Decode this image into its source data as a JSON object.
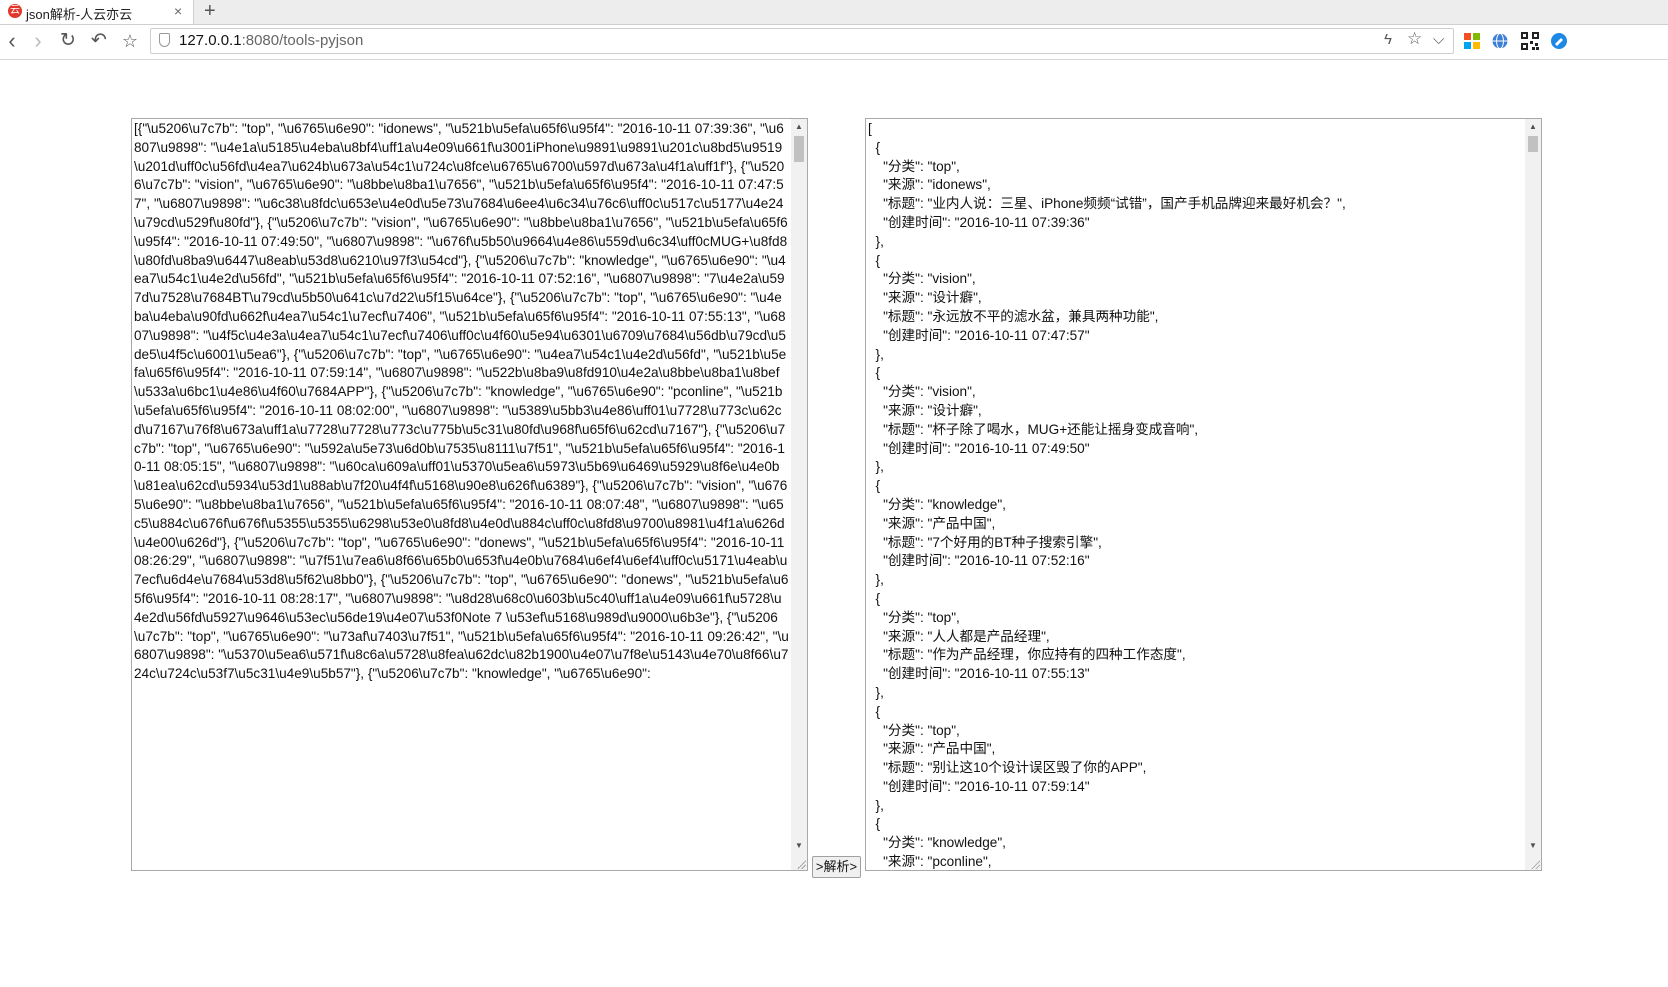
{
  "browser": {
    "tab": {
      "favicon": "云",
      "title": "json解析-人云亦云",
      "close": "×"
    },
    "new_tab": "+",
    "address": {
      "host": "127.0.0.1",
      "rest": ":8080/tools-pyjson"
    },
    "icons": [
      "back-icon",
      "forward-icon",
      "reload-icon",
      "undo-icon",
      "star-icon",
      "shield-icon",
      "lightning-icon",
      "bookmark-star-icon",
      "dropdown-icon",
      "apps-icon",
      "globe-icon",
      "qr-code-icon",
      "extension-icon"
    ],
    "glyphs": {
      "back": "‹",
      "forward": "›",
      "reload": "↻",
      "undo": "↶",
      "star": "☆",
      "lightning": "ϟ",
      "dropdown": "⌵"
    }
  },
  "input": {
    "text": "[{\"\\u5206\\u7c7b\": \"top\", \"\\u6765\\u6e90\": \"idonews\", \"\\u521b\\u5efa\\u65f6\\u95f4\": \"2016-10-11 07:39:36\", \"\\u6807\\u9898\": \"\\u4e1a\\u5185\\u4eba\\u8bf4\\uff1a\\u4e09\\u661f\\u3001iPhone\\u9891\\u9891\\u201c\\u8bd5\\u9519\\u201d\\uff0c\\u56fd\\u4ea7\\u624b\\u673a\\u54c1\\u724c\\u8fce\\u6765\\u6700\\u597d\\u673a\\u4f1a\\uff1f\"}, {\"\\u5206\\u7c7b\": \"vision\", \"\\u6765\\u6e90\": \"\\u8bbe\\u8ba1\\u7656\", \"\\u521b\\u5efa\\u65f6\\u95f4\": \"2016-10-11 07:47:57\", \"\\u6807\\u9898\": \"\\u6c38\\u8fdc\\u653e\\u4e0d\\u5e73\\u7684\\u6ee4\\u6c34\\u76c6\\uff0c\\u517c\\u5177\\u4e24\\u79cd\\u529f\\u80fd\"}, {\"\\u5206\\u7c7b\": \"vision\", \"\\u6765\\u6e90\": \"\\u8bbe\\u8ba1\\u7656\", \"\\u521b\\u5efa\\u65f6\\u95f4\": \"2016-10-11 07:49:50\", \"\\u6807\\u9898\": \"\\u676f\\u5b50\\u9664\\u4e86\\u559d\\u6c34\\uff0cMUG+\\u8fd8\\u80fd\\u8ba9\\u6447\\u8eab\\u53d8\\u6210\\u97f3\\u54cd\"}, {\"\\u5206\\u7c7b\": \"knowledge\", \"\\u6765\\u6e90\": \"\\u4ea7\\u54c1\\u4e2d\\u56fd\", \"\\u521b\\u5efa\\u65f6\\u95f4\": \"2016-10-11 07:52:16\", \"\\u6807\\u9898\": \"7\\u4e2a\\u597d\\u7528\\u7684BT\\u79cd\\u5b50\\u641c\\u7d22\\u5f15\\u64ce\"}, {\"\\u5206\\u7c7b\": \"top\", \"\\u6765\\u6e90\": \"\\u4eba\\u4eba\\u90fd\\u662f\\u4ea7\\u54c1\\u7ecf\\u7406\", \"\\u521b\\u5efa\\u65f6\\u95f4\": \"2016-10-11 07:55:13\", \"\\u6807\\u9898\": \"\\u4f5c\\u4e3a\\u4ea7\\u54c1\\u7ecf\\u7406\\uff0c\\u4f60\\u5e94\\u6301\\u6709\\u7684\\u56db\\u79cd\\u5de5\\u4f5c\\u6001\\u5ea6\"}, {\"\\u5206\\u7c7b\": \"top\", \"\\u6765\\u6e90\": \"\\u4ea7\\u54c1\\u4e2d\\u56fd\", \"\\u521b\\u5efa\\u65f6\\u95f4\": \"2016-10-11 07:59:14\", \"\\u6807\\u9898\": \"\\u522b\\u8ba9\\u8fd910\\u4e2a\\u8bbe\\u8ba1\\u8bef\\u533a\\u6bc1\\u4e86\\u4f60\\u7684APP\"}, {\"\\u5206\\u7c7b\": \"knowledge\", \"\\u6765\\u6e90\": \"pconline\", \"\\u521b\\u5efa\\u65f6\\u95f4\": \"2016-10-11 08:02:00\", \"\\u6807\\u9898\": \"\\u5389\\u5bb3\\u4e86\\uff01\\u7728\\u773c\\u62cd\\u7167\\u76f8\\u673a\\uff1a\\u7728\\u7728\\u773c\\u775b\\u5c31\\u80fd\\u968f\\u65f6\\u62cd\\u7167\"}, {\"\\u5206\\u7c7b\": \"top\", \"\\u6765\\u6e90\": \"\\u592a\\u5e73\\u6d0b\\u7535\\u8111\\u7f51\", \"\\u521b\\u5efa\\u65f6\\u95f4\": \"2016-10-11 08:05:15\", \"\\u6807\\u9898\": \"\\u60ca\\u609a\\uff01\\u5370\\u5ea6\\u5973\\u5b69\\u6469\\u5929\\u8f6e\\u4e0b\\u81ea\\u62cd\\u5934\\u53d1\\u88ab\\u7f20\\u4f4f\\u5168\\u90e8\\u626f\\u6389\"}, {\"\\u5206\\u7c7b\": \"vision\", \"\\u6765\\u6e90\": \"\\u8bbe\\u8ba1\\u7656\", \"\\u521b\\u5efa\\u65f6\\u95f4\": \"2016-10-11 08:07:48\", \"\\u6807\\u9898\": \"\\u65c5\\u884c\\u676f\\u676f\\u5355\\u5355\\u6298\\u53e0\\u8fd8\\u4e0d\\u884c\\uff0c\\u8fd8\\u9700\\u8981\\u4f1a\\u626d\\u4e00\\u626d\"}, {\"\\u5206\\u7c7b\": \"top\", \"\\u6765\\u6e90\": \"donews\", \"\\u521b\\u5efa\\u65f6\\u95f4\": \"2016-10-11 08:26:29\", \"\\u6807\\u9898\": \"\\u7f51\\u7ea6\\u8f66\\u65b0\\u653f\\u4e0b\\u7684\\u6ef4\\u6ef4\\uff0c\\u5171\\u4eab\\u7ecf\\u6d4e\\u7684\\u53d8\\u5f62\\u8bb0\"}, {\"\\u5206\\u7c7b\": \"top\", \"\\u6765\\u6e90\": \"donews\", \"\\u521b\\u5efa\\u65f6\\u95f4\": \"2016-10-11 08:28:17\", \"\\u6807\\u9898\": \"\\u8d28\\u68c0\\u603b\\u5c40\\uff1a\\u4e09\\u661f\\u5728\\u4e2d\\u56fd\\u5927\\u9646\\u53ec\\u56de19\\u4e07\\u53f0Note 7 \\u53ef\\u5168\\u989d\\u9000\\u6b3e\"}, {\"\\u5206\\u7c7b\": \"top\", \"\\u6765\\u6e90\": \"\\u73af\\u7403\\u7f51\", \"\\u521b\\u5efa\\u65f6\\u95f4\": \"2016-10-11 09:26:42\", \"\\u6807\\u9898\": \"\\u5370\\u5ea6\\u571f\\u8c6a\\u5728\\u8fea\\u62dc\\u82b1900\\u4e07\\u7f8e\\u5143\\u4e70\\u8f66\\u724c\\u724c\\u53f7\\u5c31\\u4e9\\u5b57\"}, {\"\\u5206\\u7c7b\": \"knowledge\", \"\\u6765\\u6e90\":"
  },
  "output": {
    "text": "[\n  {\n    \"分类\": \"top\",\n    \"来源\": \"idonews\",\n    \"标题\": \"业内人说：三星、iPhone频频“试错”，国产手机品牌迎来最好机会？\",\n    \"创建时间\": \"2016-10-11 07:39:36\"\n  },\n  {\n    \"分类\": \"vision\",\n    \"来源\": \"设计癖\",\n    \"标题\": \"永远放不平的滤水盆，兼具两种功能\",\n    \"创建时间\": \"2016-10-11 07:47:57\"\n  },\n  {\n    \"分类\": \"vision\",\n    \"来源\": \"设计癖\",\n    \"标题\": \"杯子除了喝水，MUG+还能让摇身变成音响\",\n    \"创建时间\": \"2016-10-11 07:49:50\"\n  },\n  {\n    \"分类\": \"knowledge\",\n    \"来源\": \"产品中国\",\n    \"标题\": \"7个好用的BT种子搜索引擎\",\n    \"创建时间\": \"2016-10-11 07:52:16\"\n  },\n  {\n    \"分类\": \"top\",\n    \"来源\": \"人人都是产品经理\",\n    \"标题\": \"作为产品经理，你应持有的四种工作态度\",\n    \"创建时间\": \"2016-10-11 07:55:13\"\n  },\n  {\n    \"分类\": \"top\",\n    \"来源\": \"产品中国\",\n    \"标题\": \"别让这10个设计误区毁了你的APP\",\n    \"创建时间\": \"2016-10-11 07:59:14\"\n  },\n  {\n    \"分类\": \"knowledge\",\n    \"来源\": \"pconline\","
  },
  "parse_button": {
    "label": ">解析>"
  },
  "scroll": {
    "input_position": 0.0,
    "output_position": 0.0
  },
  "colors": {
    "favicon": "#e2372b",
    "scroll_thumb": "#c1c1c1"
  }
}
